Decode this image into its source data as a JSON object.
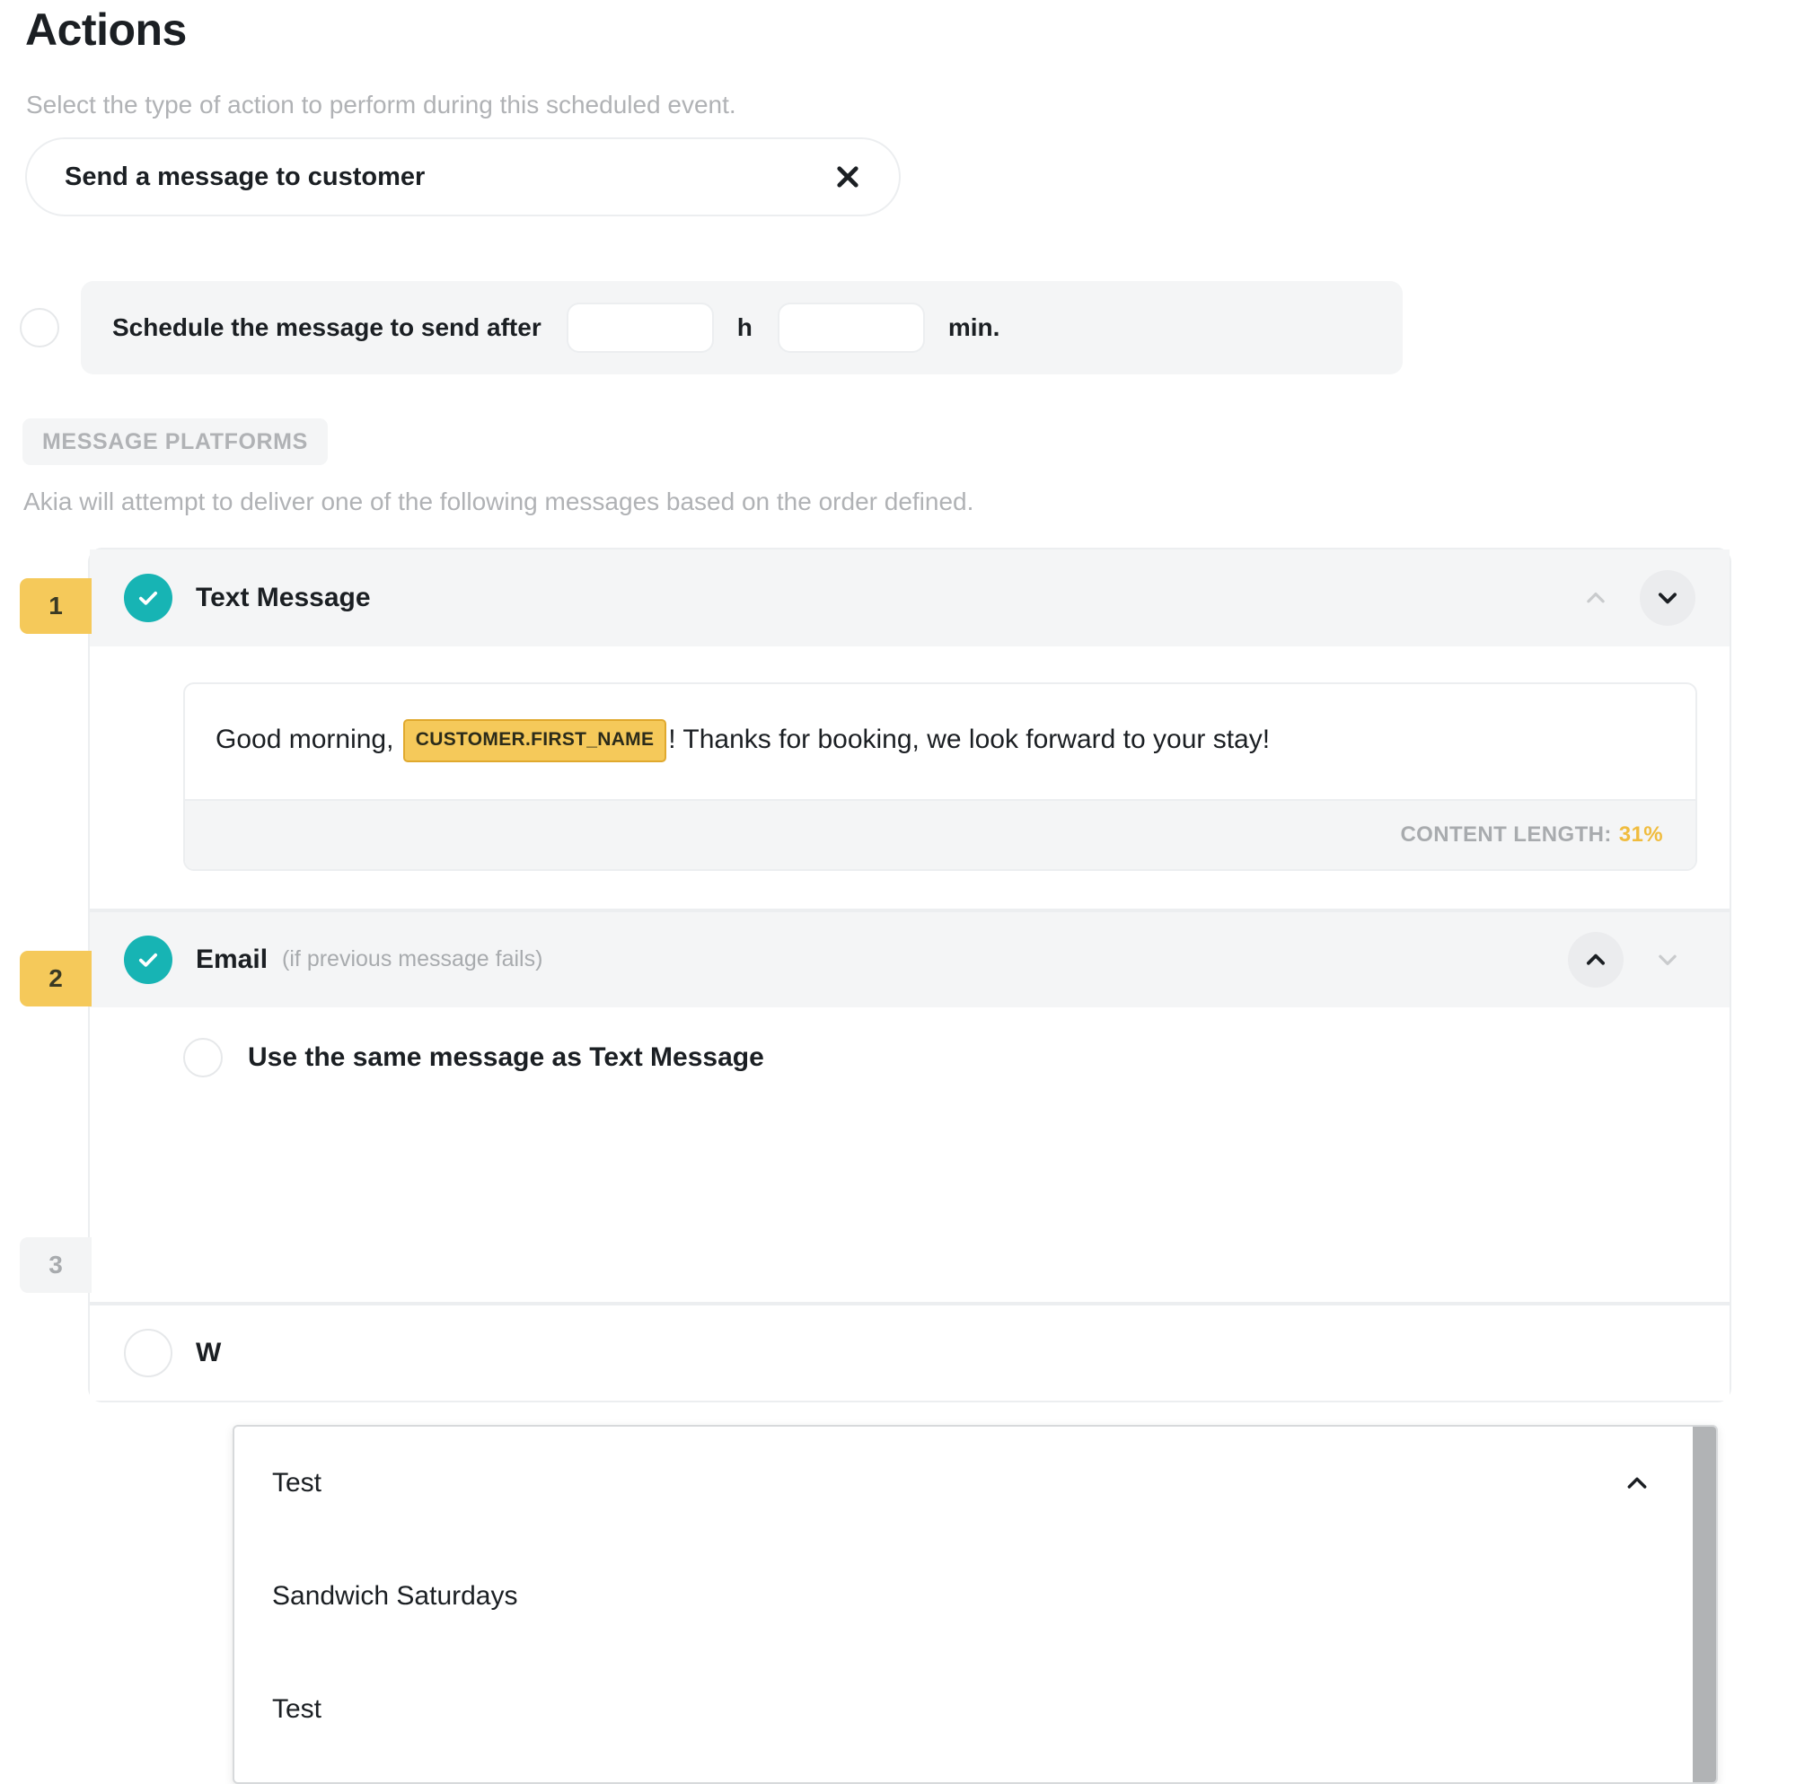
{
  "page": {
    "title": "Actions",
    "subtitle": "Select the type of action to perform during this scheduled event."
  },
  "action_select": {
    "value": "Send a message to customer",
    "clear_icon": "close-icon"
  },
  "schedule": {
    "radio_selected": false,
    "label": "Schedule the message to send after",
    "hours_value": "",
    "hours_placeholder": "",
    "hours_unit": "h",
    "minutes_value": "",
    "minutes_placeholder": "",
    "minutes_unit": "min."
  },
  "platforms_section": {
    "chip_label": "MESSAGE PLATFORMS",
    "description": "Akia will attempt to deliver one of the following messages based on the order defined."
  },
  "platforms": [
    {
      "order": "1",
      "order_state": "active",
      "enabled": true,
      "title": "Text Message",
      "subtitle": "",
      "move_up_enabled": false,
      "move_down_enabled": true,
      "message": {
        "prefix": "Good morning, ",
        "token": "CUSTOMER.FIRST_NAME",
        "suffix": "! Thanks for booking, we look forward to your stay!",
        "content_length_label": "CONTENT LENGTH:",
        "content_length_value": "31%"
      }
    },
    {
      "order": "2",
      "order_state": "active",
      "enabled": true,
      "title": "Email",
      "subtitle": "(if previous message fails)",
      "move_up_enabled": true,
      "move_down_enabled": false,
      "same_message_radio": {
        "label": "Use the same message as Text Message",
        "selected": false
      }
    },
    {
      "order": "3",
      "order_state": "inactive",
      "enabled": false,
      "title": "W",
      "subtitle": "",
      "move_up_enabled": false,
      "move_down_enabled": false
    }
  ],
  "dropdown": {
    "open": true,
    "selected": "Test",
    "collapse_icon": "chevron-up-icon",
    "options": [
      "Test",
      "Sandwich Saturdays",
      "Test"
    ]
  },
  "colors": {
    "accent_teal": "#17b4b4",
    "badge_yellow": "#f5c95a",
    "token_yellow": "#f5c95a",
    "content_length_yellow": "#f0bc3e",
    "muted_gray": "#b0b2b5"
  }
}
